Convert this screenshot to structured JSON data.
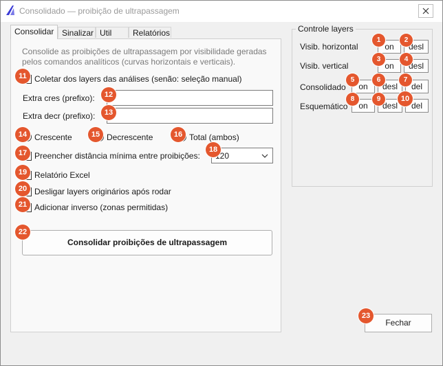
{
  "window": {
    "title": "Consolidado — proibição de ultrapassagem"
  },
  "tabs": [
    "Consolidar",
    "Sinalizar",
    "Util",
    "Relatórios"
  ],
  "consolidar": {
    "description": "Consolide as proibições de ultrapassagem por visibilidade geradas pelos comandos analíticos (curvas horizontais e verticais).",
    "collect_layers_label": "Coletar dos layers das análises (senão: seleção manual)",
    "extra_cres_label": "Extra cres (prefixo):",
    "extra_cres_value": "",
    "extra_decr_label": "Extra decr (prefixo):",
    "extra_decr_value": "",
    "radio_crescente": "Crescente",
    "radio_decrescente": "Decrescente",
    "radio_total": "Total (ambos)",
    "fill_min_distance_label": "Preencher distância mínima entre proibições:",
    "min_distance_value": "120",
    "excel_report_label": "Relatório Excel",
    "turn_off_layers_label": "Desligar layers originários após rodar",
    "add_inverse_label": "Adicionar inverso (zonas permitidas)",
    "consolidate_button": "Consolidar proibições de ultrapassagem"
  },
  "layer_control": {
    "title": "Controle layers",
    "rows": [
      {
        "label": "Visib. horizontal",
        "buttons": [
          "on",
          "desl"
        ]
      },
      {
        "label": "Visib. vertical",
        "buttons": [
          "on",
          "desl"
        ]
      },
      {
        "label": "Consolidado",
        "buttons": [
          "on",
          "desl",
          "del"
        ]
      },
      {
        "label": "Esquemático",
        "buttons": [
          "on",
          "desl",
          "del"
        ]
      }
    ]
  },
  "close_button": "Fechar",
  "badges": [
    "1",
    "2",
    "3",
    "4",
    "5",
    "6",
    "7",
    "8",
    "9",
    "10",
    "11",
    "12",
    "13",
    "14",
    "15",
    "16",
    "17",
    "18",
    "19",
    "20",
    "21",
    "22",
    "23"
  ],
  "colors": {
    "badge": "#e4572e",
    "accent_icon": "#3b3bd6"
  }
}
